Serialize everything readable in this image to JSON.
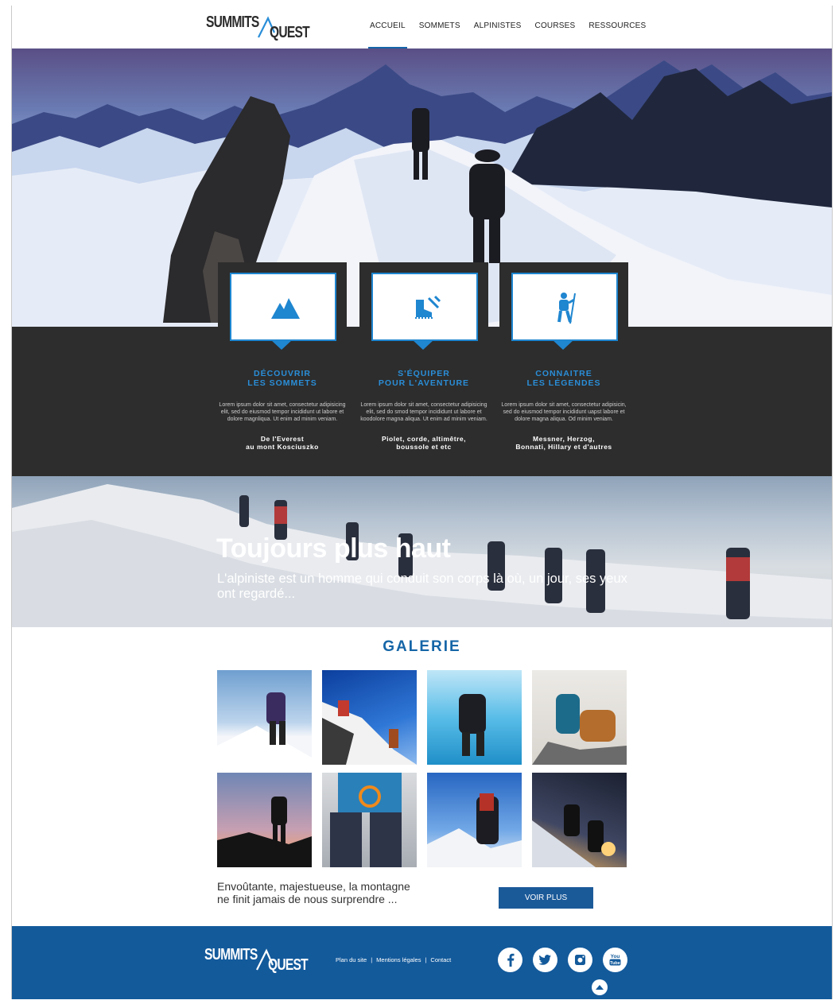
{
  "brand": {
    "word1": "SUMMITS",
    "word2": "QUEST"
  },
  "nav": {
    "items": [
      "ACCUEIL",
      "SOMMETS",
      "ALPINISTES",
      "COURSES",
      "RESSOURCES"
    ],
    "active": "ACCUEIL"
  },
  "features": [
    {
      "icon": "mountain-icon",
      "title_l1": "DÉCOUVRIR",
      "title_l2": "LES SOMMETS",
      "text": "Lorem ipsum dolor sit amet, consectetur adipisicing elit, sed do eiusmod tempor incididunt ut labore et dolore magnliqua. Ut enim ad minim veniam.",
      "sub_l1": "De l'Everest",
      "sub_l2": "au mont Kosciuszko"
    },
    {
      "icon": "boot-ice-axe-icon",
      "title_l1": "S'ÉQUIPER",
      "title_l2": "POUR L'AVENTURE",
      "text": "Lorem ipsum dolor sit amet, consectetur adipisicing elit, sed do smod tempor incididunt ut labore et koodolore magna aliqua. Ut enim ad minim veniam.",
      "sub_l1": "Piolet, corde, altimêtre,",
      "sub_l2": "boussole et etc"
    },
    {
      "icon": "climber-icon",
      "title_l1": "CONNAITRE",
      "title_l2": "LES LÉGENDES",
      "text": "Lorem ipsum dolor sit amet, consectetur adipisicin, sed do eiusmod tempor incididunt uapst labore et dolore magna aliqua. Od minim veniam.",
      "sub_l1": "Messner, Herzog,",
      "sub_l2": "Bonnati, Hillary et d'autres"
    }
  ],
  "banner": {
    "headline": "Toujours plus haut",
    "quote": "L'alpiniste est un homme qui conduit son corps là où, un jour, ses yeux ont regardé..."
  },
  "gallery": {
    "title": "GALERIE",
    "tagline_l1": "Envoûtante, majestueuse, la montagne",
    "tagline_l2": "ne finit jamais de nous surprendre ...",
    "button": "VOIR PLUS"
  },
  "footer": {
    "links": [
      "Plan du site",
      "Mentions légales",
      "Contact"
    ],
    "social": [
      "facebook-icon",
      "twitter-icon",
      "instagram-icon",
      "youtube-icon"
    ],
    "youtube_l1": "You",
    "youtube_l2": "Tube"
  },
  "colors": {
    "primary": "#1565a7",
    "accent": "#1f86d0",
    "dark": "#2d2d2d",
    "footer": "#135a9b"
  }
}
